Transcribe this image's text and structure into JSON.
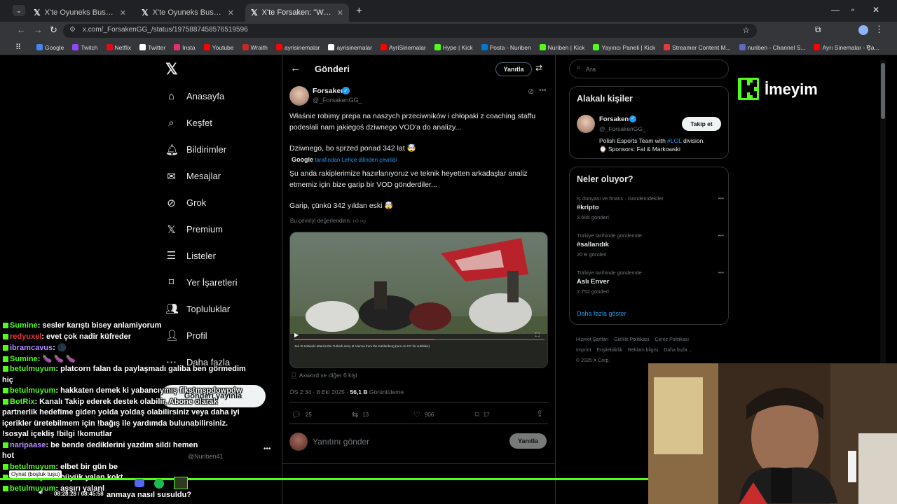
{
  "browser": {
    "tabs": [
      {
        "label": "X'te Oyuneks Bushido Wildcat:",
        "active": false
      },
      {
        "label": "X'te Oyuneks Bushido Wildcat:",
        "active": false
      },
      {
        "label": "X'te Forsaken: \"Właśnie robimy",
        "active": true
      }
    ],
    "url": "x.com/_ForsakenGG_/status/1975887458576519596",
    "bookmarks": [
      {
        "label": "Google",
        "color": "#4285f4"
      },
      {
        "label": "Twitch",
        "color": "#9146ff"
      },
      {
        "label": "Netflix",
        "color": "#e50914"
      },
      {
        "label": "Twitter",
        "color": "#ffffff"
      },
      {
        "label": "Insta",
        "color": "#e1306c"
      },
      {
        "label": "Youtube",
        "color": "#ff0000"
      },
      {
        "label": "Wraith",
        "color": "#c62828"
      },
      {
        "label": "ayrisinemalar",
        "color": "#ff0000"
      },
      {
        "label": "ayrisinemalar",
        "color": "#ffffff"
      },
      {
        "label": "AyriSinemalar",
        "color": "#ff0000"
      },
      {
        "label": "Hype | Kick",
        "color": "#53fc18"
      },
      {
        "label": "Posta - Nuriben",
        "color": "#0078d4"
      },
      {
        "label": "Nuriben | Kick",
        "color": "#53fc18"
      },
      {
        "label": "Yayıncı Paneli | Kick",
        "color": "#53fc18"
      },
      {
        "label": "Streamer Content M...",
        "color": "#e53935"
      },
      {
        "label": "nuriben - Channel S...",
        "color": "#5c6bc0"
      },
      {
        "label": "Ayrı Sinemalar - Ça...",
        "color": "#ff0000"
      }
    ]
  },
  "sidebar": {
    "items": [
      {
        "label": "Anasayfa",
        "icon": "home-icon"
      },
      {
        "label": "Keşfet",
        "icon": "search-icon"
      },
      {
        "label": "Bildirimler",
        "icon": "bell-icon"
      },
      {
        "label": "Mesajlar",
        "icon": "mail-icon"
      },
      {
        "label": "Grok",
        "icon": "grok-icon"
      },
      {
        "label": "Premium",
        "icon": "x-icon"
      },
      {
        "label": "Listeler",
        "icon": "list-icon"
      },
      {
        "label": "Yer İşaretleri",
        "icon": "bookmark-icon"
      },
      {
        "label": "Topluluklar",
        "icon": "people-icon"
      },
      {
        "label": "Profil",
        "icon": "person-icon"
      },
      {
        "label": "Daha fazla",
        "icon": "more-icon"
      }
    ],
    "post_button": "Gönderi yayınla",
    "account_handle": "@Nuriben41"
  },
  "post": {
    "header_title": "Gönderi",
    "reply_top_button": "Yanıtla",
    "author_name": "Forsaken",
    "author_handle": "@_ForsakenGG_",
    "text_p1": "Właśnie robimy prepa na naszych przeciwników i chłopaki z coaching staffu podesłali nam jakiegoś dziwnego VOD'a do analizy...",
    "text_p2": "Dziwnego, bo sprzed ponad 342 lat 🤯",
    "translated_by": "Google",
    "translated_note": "tarafından Lehçe dilinden çevrildi",
    "translation_p1": "Şu anda rakiplerimize hazırlanıyoruz ve teknik heyetten arkadaşlar analiz etmemiz için bize garip bir VOD gönderdiler...",
    "translation_p2": "Garip, çünkü 342 yıldan eski 🤯",
    "rate_translation": "Bu çeviriyi değerlendirin:",
    "video_caption": "Jan III Sobieski attacks the Turkish army at Vienna from the Kahlenberg (turn on CC for subtitles)",
    "tagged": "Axword ve diğer 6 kişi",
    "timestamp": "ÖS 2:34 · 8 Eki 2025 ·",
    "views_count": "56,1 B",
    "views_label": "Görüntüleme",
    "stats": {
      "replies": "25",
      "reposts": "13",
      "likes": "906",
      "bookmarks": "17"
    },
    "reply_placeholder": "Yanıtını gönder",
    "reply_button": "Yanıtla"
  },
  "right": {
    "search_placeholder": "Ara",
    "related_title": "Alakalı kişiler",
    "related_name": "Forsaken",
    "related_handle": "@_ForsakenGG_",
    "related_bio_a": "Polish Esports Team with ",
    "related_bio_link": "#LOL",
    "related_bio_b": " division.",
    "related_bio_2": "⌚ Sponsors: Fal & Markowski",
    "follow_button": "Takip et",
    "trends_title": "Neler oluyor?",
    "trends": [
      {
        "category": "İş dünyası ve finans · Gündemdekiler",
        "title": "#kripto",
        "count": "3.695 gönderi"
      },
      {
        "category": "Türkiye tarihinde gündemde",
        "title": "#sallandık",
        "count": "20 B gönderi"
      },
      {
        "category": "Türkiye tarihinde gündemde",
        "title": "Aslı Enver",
        "count": "2.752 gönderi"
      }
    ],
    "show_more": "Daha fazla göster",
    "footer_line1": [
      "Hizmet Şartları",
      "Gizlilik Politikası",
      "Çerez Politikası"
    ],
    "footer_line2": [
      "Imprint",
      "Erişilebilirlik",
      "Reklam bilgisi",
      "Daha fazla ..."
    ],
    "copyright": "© 2025 X Corp."
  },
  "overlay": {
    "brand_text": "İmeyim",
    "brand_color": "#53fc18",
    "chat": [
      {
        "user": "Sumine",
        "msg": ": sesler karıştı bisey anlamiyorum",
        "color": "#53fc18"
      },
      {
        "user": "redyuxel",
        "msg": ": evet çok nadir küfreder",
        "color": "#e53935"
      },
      {
        "user": "ibramcavus",
        "msg": ": 🌑",
        "color": "#b388ff"
      },
      {
        "user": "Sumine",
        "msg": ": 🍆 🍆 🍆",
        "color": "#53fc18"
      },
      {
        "user": "betulmuyum",
        "msg": ": platcorn falan da paylaşmadı galiba ben görmedim",
        "color": "#53fc18"
      },
      {
        "user": "",
        "msg": "hiç",
        "color": "#53fc18"
      },
      {
        "user": "betulmuyum",
        "msg": ": hakkaten demek ki yabancıymış fikstmspdowpdw",
        "color": "#53fc18"
      },
      {
        "user": "BotRix",
        "msg": ": Kanalı Takip ederek destek olabilir, Abone olarak",
        "color": "#53fc18"
      },
      {
        "user": "",
        "msg": "partnerlik hedefime giden yolda yoldaş olabilirsiniz veya daha iyi",
        "color": "#53fc18"
      },
      {
        "user": "",
        "msg": "içerikler üretebilmem için !bağış ile yardımda bulunabilirsiniz.",
        "color": "#53fc18"
      },
      {
        "user": "",
        "msg": "!sosyal içekliş !bilgi !komutlar",
        "color": "#53fc18"
      },
      {
        "user": "naripaase",
        "msg": ": be bende dediklerini yazdım sildi hemen",
        "color": "#b388ff"
      },
      {
        "user": "",
        "msg": "hot",
        "color": "#53fc18"
      },
      {
        "user": "betulmuyum",
        "msg": ": elbet bir gün be",
        "color": "#53fc18"
      },
      {
        "user": "betulmuyum",
        "msg": ": büyük yalan kokt",
        "color": "#53fc18"
      },
      {
        "user": "betulmuyum",
        "msg": ": aşşırı yalanl",
        "color": "#53fc18"
      }
    ],
    "tooltip": "Oynat (boşluk tuşu)",
    "player_time": "08:28:28 / 08:45:58",
    "player_extra": "anmaya nasıl susuldu?"
  }
}
